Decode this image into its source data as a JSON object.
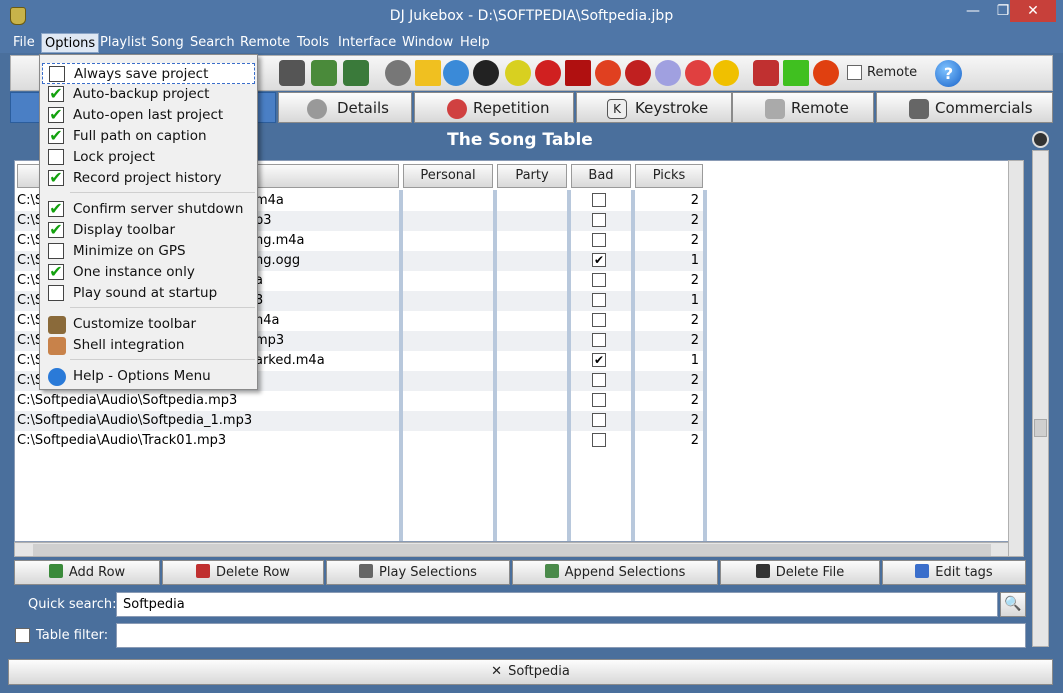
{
  "window": {
    "title": "DJ Jukebox - D:\\SOFTPEDIA\\Softpedia.jbp",
    "min_icon": "—",
    "max_icon": "❐",
    "close_icon": "✕"
  },
  "menubar": [
    "File",
    "Options",
    "Playlist",
    "Song",
    "Search",
    "Remote",
    "Tools",
    "Interface",
    "Window",
    "Help"
  ],
  "toolbar": {
    "remote_label": "Remote",
    "help_glyph": "?"
  },
  "tabs": [
    "Details",
    "Repetition",
    "Keystroke",
    "Remote",
    "Commercials"
  ],
  "tab_keystroke_glyph": "K",
  "section_title": "The Song Table",
  "table": {
    "columns": [
      "Personal",
      "Party",
      "Bad",
      "Picks"
    ],
    "rows": [
      {
        "name": "C:\\So",
        "suffix": "m4a",
        "bad": "",
        "picks": "2"
      },
      {
        "name": "C:\\So",
        "suffix": "p3",
        "bad": "",
        "picks": "2"
      },
      {
        "name": "C:\\So",
        "suffix": "ng.m4a",
        "bad": "",
        "picks": "2"
      },
      {
        "name": "C:\\So",
        "suffix": "ng.ogg",
        "bad": "✔",
        "picks": "1"
      },
      {
        "name": "C:\\So",
        "suffix": "a",
        "bad": "",
        "picks": "2"
      },
      {
        "name": "C:\\So",
        "suffix": "3",
        "bad": "",
        "picks": "1"
      },
      {
        "name": "C:\\So",
        "suffix": "n4a",
        "bad": "",
        "picks": "2"
      },
      {
        "name": "C:\\So",
        "suffix": "mp3",
        "bad": "",
        "picks": "2"
      },
      {
        "name": "C:\\So",
        "suffix": "arked.m4a",
        "bad": "✔",
        "picks": "1"
      },
      {
        "name": "C:\\So",
        "suffix": "",
        "bad": "",
        "picks": "2"
      },
      {
        "name": "C:\\Softpedia\\Audio\\Softpedia.mp3",
        "suffix": "",
        "bad": "",
        "picks": "2"
      },
      {
        "name": "C:\\Softpedia\\Audio\\Softpedia_1.mp3",
        "suffix": "",
        "bad": "",
        "picks": "2"
      },
      {
        "name": "C:\\Softpedia\\Audio\\Track01.mp3",
        "suffix": "",
        "bad": "",
        "picks": "2"
      }
    ]
  },
  "actions": [
    "Add Row",
    "Delete Row",
    "Play Selections",
    "Append Selections",
    "Delete File",
    "Edit tags"
  ],
  "quick_search": {
    "label": "Quick search:",
    "value": "Softpedia",
    "button_glyph": "🔍"
  },
  "table_filter": {
    "label": "Table filter:",
    "value": ""
  },
  "status": {
    "glyph": "✕",
    "text": "Softpedia"
  },
  "options_menu": [
    {
      "label": "Always save project",
      "check": ""
    },
    {
      "label": "Auto-backup project",
      "check": "✔"
    },
    {
      "label": "Auto-open last project",
      "check": "✔"
    },
    {
      "label": "Full path on caption",
      "check": "✔"
    },
    {
      "label": "Lock project",
      "check": ""
    },
    {
      "label": "Record project history",
      "check": "✔"
    },
    {
      "label": "Confirm server shutdown",
      "check": "✔"
    },
    {
      "label": "Display toolbar",
      "check": "✔"
    },
    {
      "label": "Minimize on GPS",
      "check": ""
    },
    {
      "label": "One instance only",
      "check": "✔"
    },
    {
      "label": "Play sound at startup",
      "check": ""
    },
    {
      "label": "Customize toolbar"
    },
    {
      "label": "Shell integration"
    },
    {
      "label": "Help - Options Menu"
    }
  ],
  "colors": {
    "window_bg": "#4a6f9c",
    "accent": "#4a7fc5",
    "check_green": "#13a10e"
  }
}
